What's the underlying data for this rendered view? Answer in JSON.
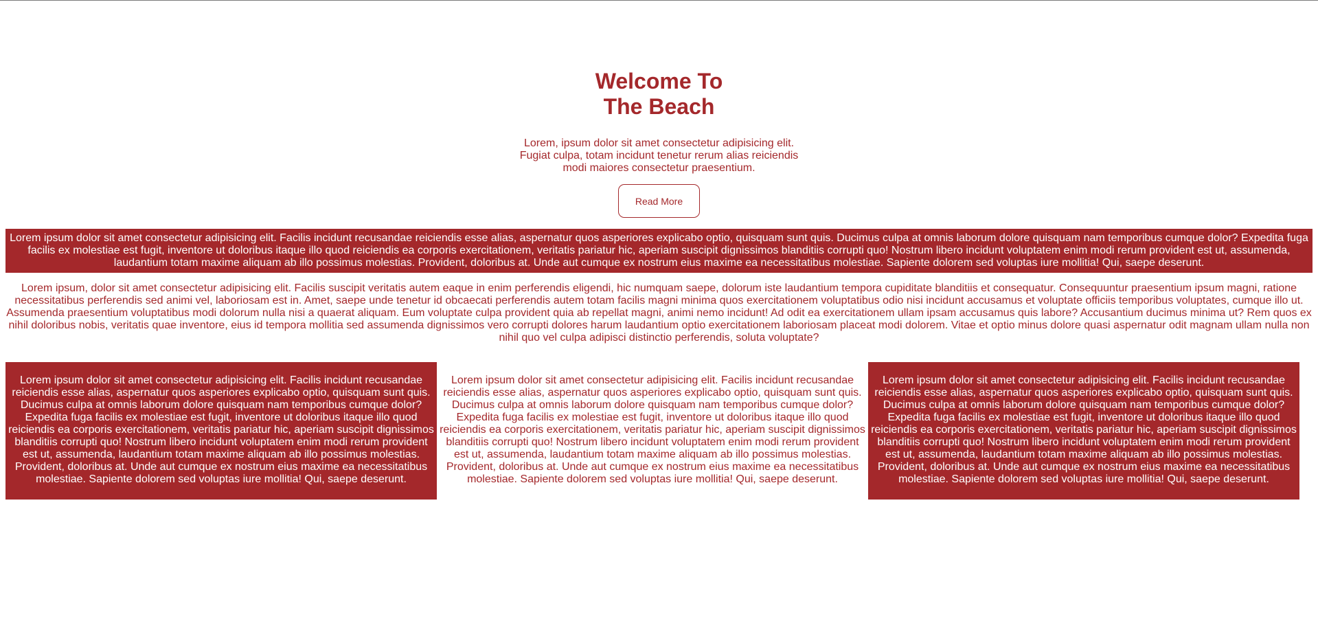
{
  "hero": {
    "title_line1": "Welcome To",
    "title_line2": "The Beach",
    "text": "Lorem, ipsum dolor sit amet consectetur adipisicing elit. Fugiat culpa, totam incidunt tenetur rerum alias reiciendis modi maiores consectetur praesentium.",
    "button_label": "Read More"
  },
  "band": {
    "text": "Lorem ipsum dolor sit amet consectetur adipisicing elit. Facilis incidunt recusandae reiciendis esse alias, aspernatur quos asperiores explicabo optio, quisquam sunt quis. Ducimus culpa at omnis laborum dolore quisquam nam temporibus cumque dolor? Expedita fuga facilis ex molestiae est fugit, inventore ut doloribus itaque illo quod reiciendis ea corporis exercitationem, veritatis pariatur hic, aperiam suscipit dignissimos blanditiis corrupti quo! Nostrum libero incidunt voluptatem enim modi rerum provident est ut, assumenda, laudantium totam maxime aliquam ab illo possimus molestias. Provident, doloribus at. Unde aut cumque ex nostrum eius maxime ea necessitatibus molestiae. Sapiente dolorem sed voluptas iure mollitia! Qui, saepe deserunt."
  },
  "paragraph": {
    "text": "Lorem ipsum, dolor sit amet consectetur adipisicing elit. Facilis suscipit veritatis autem eaque in enim perferendis eligendi, hic numquam saepe, dolorum iste laudantium tempora cupiditate blanditiis et consequatur. Consequuntur praesentium ipsum magni, ratione necessitatibus perferendis sed animi vel, laboriosam est in. Amet, saepe unde tenetur id obcaecati perferendis autem totam facilis magni minima quos exercitationem voluptatibus odio nisi incidunt accusamus et voluptate officiis temporibus voluptates, cumque illo ut. Assumenda praesentium voluptatibus modi dolorum nulla nisi a quaerat aliquam. Eum voluptate culpa provident quia ab repellat magni, animi nemo incidunt! Ad odit ea exercitationem ullam ipsam accusamus quis labore? Accusantium ducimus minima ut? Rem quos ex nihil doloribus nobis, veritatis quae inventore, eius id tempora mollitia sed assumenda dignissimos vero corrupti dolores harum laudantium optio exercitationem laboriosam placeat modi dolorem. Vitae et optio minus dolore quasi aspernatur odit magnam ullam nulla non nihil quo vel culpa adipisci distinctio perferendis, soluta voluptate?"
  },
  "columns": [
    {
      "text": "Lorem ipsum dolor sit amet consectetur adipisicing elit. Facilis incidunt recusandae reiciendis esse alias, aspernatur quos asperiores explicabo optio, quisquam sunt quis. Ducimus culpa at omnis laborum dolore quisquam nam temporibus cumque dolor? Expedita fuga facilis ex molestiae est fugit, inventore ut doloribus itaque illo quod reiciendis ea corporis exercitationem, veritatis pariatur hic, aperiam suscipit dignissimos blanditiis corrupti quo! Nostrum libero incidunt voluptatem enim modi rerum provident est ut, assumenda, laudantium totam maxime aliquam ab illo possimus molestias. Provident, doloribus at. Unde aut cumque ex nostrum eius maxime ea necessitatibus molestiae. Sapiente dolorem sed voluptas iure mollitia! Qui, saepe deserunt."
    },
    {
      "text": "Lorem ipsum dolor sit amet consectetur adipisicing elit. Facilis incidunt recusandae reiciendis esse alias, aspernatur quos asperiores explicabo optio, quisquam sunt quis. Ducimus culpa at omnis laborum dolore quisquam nam temporibus cumque dolor? Expedita fuga facilis ex molestiae est fugit, inventore ut doloribus itaque illo quod reiciendis ea corporis exercitationem, veritatis pariatur hic, aperiam suscipit dignissimos blanditiis corrupti quo! Nostrum libero incidunt voluptatem enim modi rerum provident est ut, assumenda, laudantium totam maxime aliquam ab illo possimus molestias. Provident, doloribus at. Unde aut cumque ex nostrum eius maxime ea necessitatibus molestiae. Sapiente dolorem sed voluptas iure mollitia! Qui, saepe deserunt."
    },
    {
      "text": "Lorem ipsum dolor sit amet consectetur adipisicing elit. Facilis incidunt recusandae reiciendis esse alias, aspernatur quos asperiores explicabo optio, quisquam sunt quis. Ducimus culpa at omnis laborum dolore quisquam nam temporibus cumque dolor? Expedita fuga facilis ex molestiae est fugit, inventore ut doloribus itaque illo quod reiciendis ea corporis exercitationem, veritatis pariatur hic, aperiam suscipit dignissimos blanditiis corrupti quo! Nostrum libero incidunt voluptatem enim modi rerum provident est ut, assumenda, laudantium totam maxime aliquam ab illo possimus molestias. Provident, doloribus at. Unde aut cumque ex nostrum eius maxime ea necessitatibus molestiae. Sapiente dolorem sed voluptas iure mollitia! Qui, saepe deserunt."
    }
  ],
  "colors": {
    "accent": "#a4282b",
    "background": "#ffffff",
    "inverse_text": "#ffffff"
  }
}
